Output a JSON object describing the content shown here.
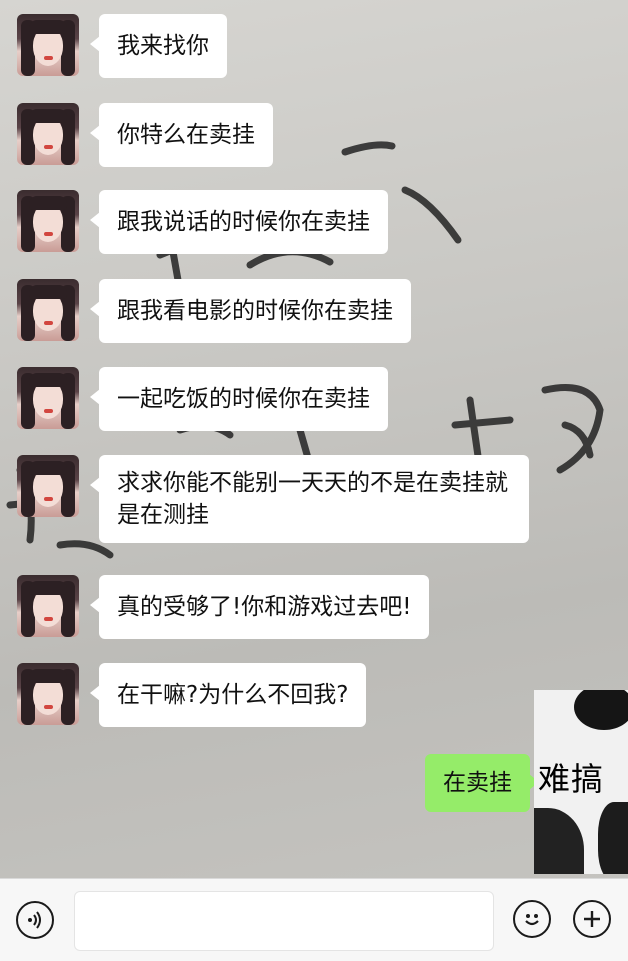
{
  "messages": [
    {
      "text": "我来找你"
    },
    {
      "text": "你特么在卖挂"
    },
    {
      "text": "跟我说话的时候你在卖挂"
    },
    {
      "text": "跟我看电影的时候你在卖挂"
    },
    {
      "text": "一起吃饭的时候你在卖挂"
    },
    {
      "text": "求求你能不能别一天天的不是在卖挂就是在测挂"
    },
    {
      "text": "真的受够了!你和游戏过去吧!"
    },
    {
      "text": "在干嘛?为什么不回我?"
    }
  ],
  "reply": {
    "text": "在卖挂"
  },
  "sticker": {
    "caption": "难搞"
  },
  "input": {
    "placeholder": ""
  },
  "icons": {
    "voice": "voice-icon",
    "emoji": "emoji-icon",
    "add": "plus-icon"
  },
  "colors": {
    "reply_bubble": "#95ec69",
    "incoming_bubble": "#ffffff"
  }
}
